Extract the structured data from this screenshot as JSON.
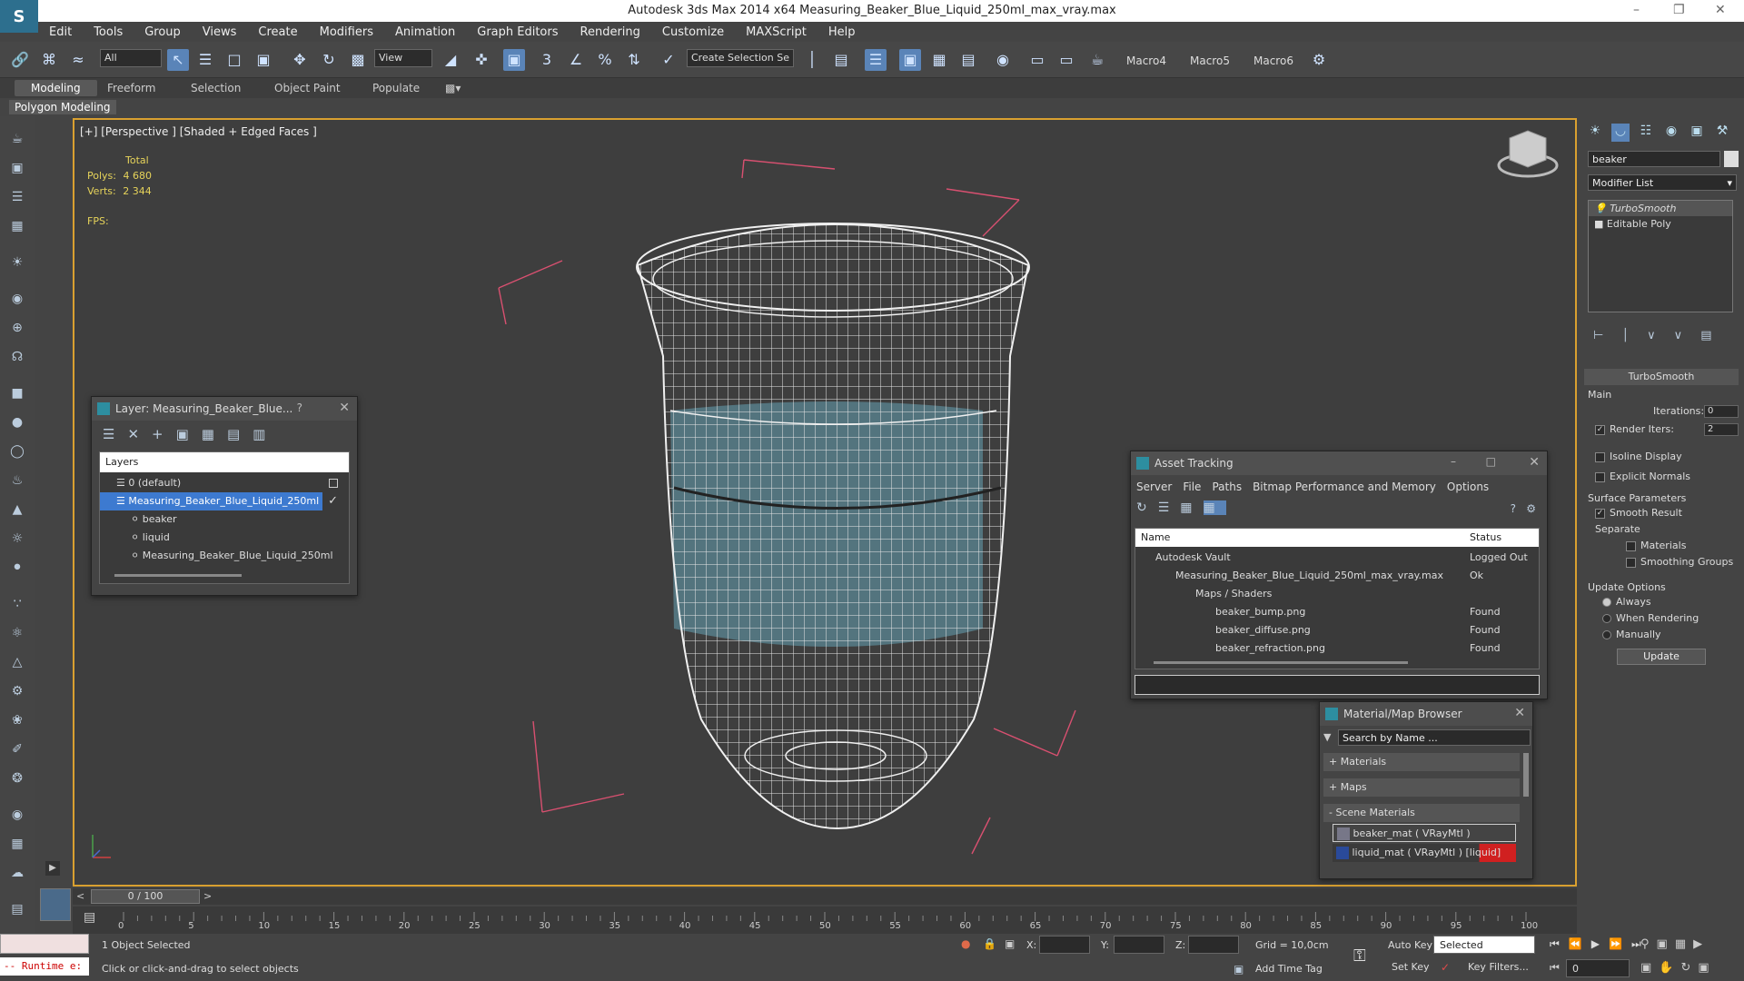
{
  "window": {
    "title": "Autodesk 3ds Max  2014 x64     Measuring_Beaker_Blue_Liquid_250ml_max_vray.max"
  },
  "menu": [
    "Edit",
    "Tools",
    "Group",
    "Views",
    "Create",
    "Modifiers",
    "Animation",
    "Graph Editors",
    "Rendering",
    "Customize",
    "MAXScript",
    "Help"
  ],
  "toolbar": {
    "filter": "All",
    "view": "View",
    "selection_set": "Create Selection Se",
    "macros": [
      "Macro4",
      "Macro5",
      "Macro6"
    ]
  },
  "ribbon": {
    "tabs": [
      "Modeling",
      "Freeform",
      "Selection",
      "Object Paint",
      "Populate"
    ],
    "panel": "Polygon Modeling"
  },
  "viewport": {
    "label": "[+] [Perspective ] [Shaded + Edged Faces ]",
    "stats_total": "Total",
    "polys_label": "Polys:",
    "polys": "4 680",
    "verts_label": "Verts:",
    "verts": "2 344",
    "fps_label": "FPS:"
  },
  "layer_dialog": {
    "title": "Layer: Measuring_Beaker_Blue...",
    "help": "?",
    "header": "Layers",
    "items": [
      "0 (default)",
      "Measuring_Beaker_Blue_Liquid_250ml",
      "beaker",
      "liquid",
      "Measuring_Beaker_Blue_Liquid_250ml"
    ]
  },
  "asset_tracking": {
    "title": "Asset Tracking",
    "menu": [
      "Server",
      "File",
      "Paths",
      "Bitmap Performance and Memory",
      "Options"
    ],
    "col_name": "Name",
    "col_status": "Status",
    "rows": [
      {
        "name": "Autodesk Vault",
        "status": "Logged Out"
      },
      {
        "name": "Measuring_Beaker_Blue_Liquid_250ml_max_vray.max",
        "status": "Ok"
      },
      {
        "name": "Maps / Shaders",
        "status": ""
      },
      {
        "name": "beaker_bump.png",
        "status": "Found"
      },
      {
        "name": "beaker_diffuse.png",
        "status": "Found"
      },
      {
        "name": "beaker_refraction.png",
        "status": "Found"
      }
    ]
  },
  "material_browser": {
    "title": "Material/Map Browser",
    "search_placeholder": "Search by Name ...",
    "groups": [
      "+ Materials",
      "+ Maps",
      "- Scene Materials"
    ],
    "materials": [
      "beaker_mat  ( VRayMtl ) [beaker]",
      "liquid_mat  ( VRayMtl ) [liquid]"
    ]
  },
  "command_panel": {
    "object_name": "beaker",
    "modifier_list": "Modifier List",
    "stack": [
      "TurboSmooth",
      "Editable Poly"
    ],
    "rollout": "TurboSmooth",
    "main": "Main",
    "iterations_label": "Iterations:",
    "iterations": "0",
    "render_iters_label": "Render Iters:",
    "render_iters": "2",
    "isoline": "Isoline Display",
    "explicit_normals": "Explicit Normals",
    "surface_params": "Surface Parameters",
    "smooth_result": "Smooth Result",
    "separate": "Separate",
    "materials": "Materials",
    "smoothing_groups": "Smoothing Groups",
    "update_options": "Update Options",
    "always": "Always",
    "when_rendering": "When Rendering",
    "manually": "Manually",
    "update_btn": "Update"
  },
  "timeline": {
    "frame": "0 / 100",
    "ticks": [
      "0",
      "5",
      "10",
      "15",
      "20",
      "25",
      "30",
      "35",
      "40",
      "45",
      "50",
      "55",
      "60",
      "65",
      "70",
      "75",
      "80",
      "85",
      "90",
      "95",
      "100"
    ]
  },
  "status": {
    "runtime": "-- Runtime e:",
    "selected": "1 Object Selected",
    "hint": "Click or click-and-drag to select objects",
    "x": "X:",
    "y": "Y:",
    "z": "Z:",
    "grid": "Grid = 10,0cm",
    "add_time_tag": "Add Time Tag",
    "auto_key": "Auto Key",
    "set_key": "Set Key",
    "key_mode": "Selected",
    "key_filters": "Key Filters...",
    "frame_field": "0"
  }
}
